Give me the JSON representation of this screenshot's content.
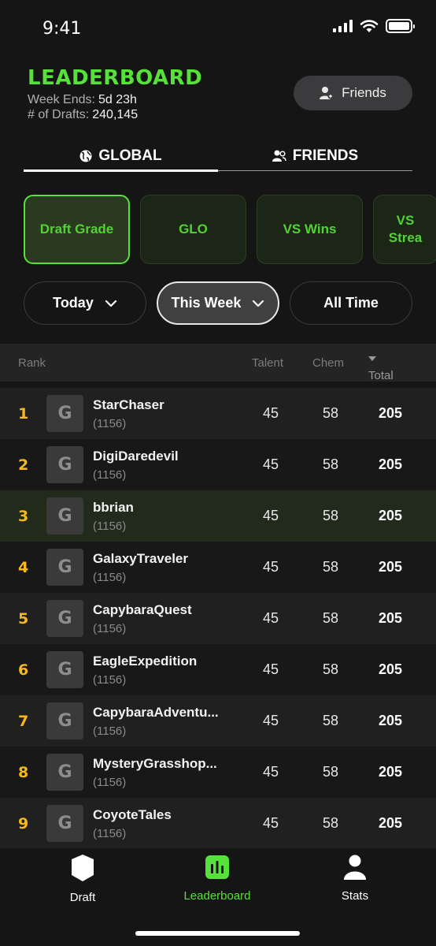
{
  "status_bar": {
    "time": "9:41"
  },
  "header": {
    "title": "LEADERBOARD",
    "week_ends_label": "Week Ends:",
    "week_ends_value": "5d 23h",
    "drafts_label": "# of Drafts:",
    "drafts_value": "240,145",
    "friends_button": "Friends"
  },
  "tabs": [
    {
      "label": "GLOBAL",
      "icon": "globe-icon",
      "active": true
    },
    {
      "label": "FRIENDS",
      "icon": "people-icon",
      "active": false
    }
  ],
  "categories": [
    {
      "label": "Draft Grade",
      "active": true
    },
    {
      "label": "GLO",
      "active": false
    },
    {
      "label": "VS Wins",
      "active": false
    },
    {
      "label": "VS\nStrea",
      "active": false
    }
  ],
  "time_filters": [
    {
      "label": "Today",
      "has_dropdown": true,
      "active": false
    },
    {
      "label": "This Week",
      "has_dropdown": true,
      "active": true
    },
    {
      "label": "All Time",
      "has_dropdown": false,
      "active": false
    }
  ],
  "table": {
    "columns": {
      "rank": "Rank",
      "talent": "Talent",
      "chem": "Chem",
      "total": "Total"
    },
    "sort_column": "Total",
    "rows": [
      {
        "rank": "1",
        "avatar": "G",
        "name": "StarChaser",
        "score": "(1156)",
        "talent": "45",
        "chem": "58",
        "total": "205"
      },
      {
        "rank": "2",
        "avatar": "G",
        "name": "DigiDaredevil",
        "score": "(1156)",
        "talent": "45",
        "chem": "58",
        "total": "205"
      },
      {
        "rank": "3",
        "avatar": "G",
        "name": "bbrian",
        "score": "(1156)",
        "talent": "45",
        "chem": "58",
        "total": "205",
        "current_user": true
      },
      {
        "rank": "4",
        "avatar": "G",
        "name": "GalaxyTraveler",
        "score": "(1156)",
        "talent": "45",
        "chem": "58",
        "total": "205"
      },
      {
        "rank": "5",
        "avatar": "G",
        "name": "CapybaraQuest",
        "score": "(1156)",
        "talent": "45",
        "chem": "58",
        "total": "205"
      },
      {
        "rank": "6",
        "avatar": "G",
        "name": "EagleExpedition",
        "score": "(1156)",
        "talent": "45",
        "chem": "58",
        "total": "205"
      },
      {
        "rank": "7",
        "avatar": "G",
        "name": "CapybaraAdventu...",
        "score": "(1156)",
        "talent": "45",
        "chem": "58",
        "total": "205"
      },
      {
        "rank": "8",
        "avatar": "G",
        "name": "MysteryGrasshop...",
        "score": "(1156)",
        "talent": "45",
        "chem": "58",
        "total": "205"
      },
      {
        "rank": "9",
        "avatar": "G",
        "name": "CoyoteTales",
        "score": "(1156)",
        "talent": "45",
        "chem": "58",
        "total": "205"
      }
    ]
  },
  "bottom_nav": [
    {
      "label": "Draft",
      "icon": "shield-icon",
      "active": false
    },
    {
      "label": "Leaderboard",
      "icon": "leaderboard-icon",
      "active": true
    },
    {
      "label": "Stats",
      "icon": "person-icon",
      "active": false
    }
  ],
  "colors": {
    "accent_green": "#56e23a",
    "rank_gold": "#f6b81a",
    "background": "#151515"
  }
}
